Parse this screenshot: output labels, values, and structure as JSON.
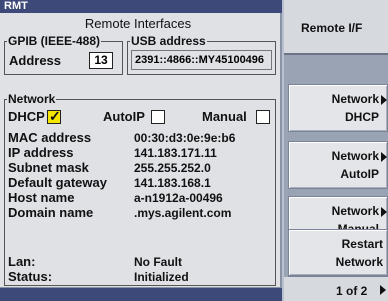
{
  "titlebar": {
    "label": "RMT"
  },
  "panel": {
    "title": "Remote Interfaces"
  },
  "gpib": {
    "legend": "GPIB (IEEE-488)",
    "address_label": "Address",
    "address_value": "13"
  },
  "usb": {
    "legend": "USB address",
    "value": "2391::4866::MY45100496"
  },
  "network": {
    "legend": "Network",
    "modes": [
      {
        "label": "DHCP",
        "checked": true
      },
      {
        "label": "AutoIP",
        "checked": false
      },
      {
        "label": "Manual",
        "checked": false
      }
    ],
    "fields": [
      {
        "label": "MAC address",
        "value": "00:30:d3:0e:9e:b6"
      },
      {
        "label": "IP address",
        "value": "141.183.171.11"
      },
      {
        "label": "Subnet mask",
        "value": "255.255.252.0"
      },
      {
        "label": "Default gateway",
        "value": "141.183.168.1"
      },
      {
        "label": "Host name",
        "value": "a-n1912a-00496"
      },
      {
        "label": "Domain name",
        "value": ".mys.agilent.com"
      }
    ],
    "status": [
      {
        "label": "Lan:",
        "value": "No Fault"
      },
      {
        "label": "Status:",
        "value": "Initialized"
      }
    ]
  },
  "softkeys": {
    "title": "Remote I/F",
    "keys": [
      {
        "line1": "Network",
        "line2": "DHCP"
      },
      {
        "line1": "Network",
        "line2": "AutoIP"
      },
      {
        "line1": "Network",
        "line2": "Manual"
      },
      {
        "line1": "Restart",
        "line2": "Network"
      }
    ],
    "page": "1 of 2"
  },
  "colors": {
    "titlebar": "#3d4a79",
    "panel": "#dfe1e5",
    "checked": "#f5e600"
  }
}
